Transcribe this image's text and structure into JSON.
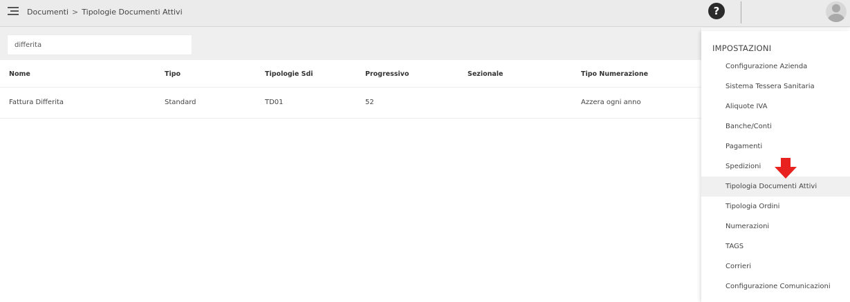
{
  "header": {
    "breadcrumb": [
      "Documenti",
      "Tipologie Documenti Attivi"
    ],
    "breadcrumb_separator": ">",
    "help_label": "?"
  },
  "search": {
    "value": "differita"
  },
  "table": {
    "columns": [
      "Nome",
      "Tipo",
      "Tipologie Sdi",
      "Progressivo",
      "Sezionale",
      "Tipo Numerazione"
    ],
    "rows": [
      [
        "Fattura Differita",
        "Standard",
        "TD01",
        "52",
        "",
        "Azzera ogni anno"
      ]
    ]
  },
  "settings_panel": {
    "title": "IMPOSTAZIONI",
    "items": [
      "Configurazione Azienda",
      "Sistema Tessera Sanitaria",
      "Aliquote IVA",
      "Banche/Conti",
      "Pagamenti",
      "Spedizioni",
      "Tipologia Documenti Attivi",
      "Tipologia Ordini",
      "Numerazioni",
      "TAGS",
      "Corrieri",
      "Configurazione Comunicazioni"
    ],
    "active_item": "Tipologia Documenti Attivi"
  },
  "colors": {
    "topbar": "#ebebeb",
    "arrow": "#e8231f",
    "active_item_bg": "#f0f0f0"
  }
}
